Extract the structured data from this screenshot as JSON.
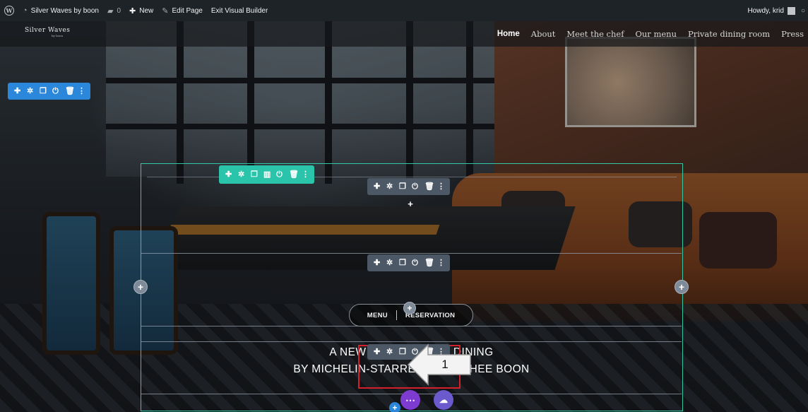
{
  "adminbar": {
    "site_name": "Silver Waves by boon",
    "comments_count": "0",
    "new_label": "New",
    "edit_page_label": "Edit Page",
    "exit_builder_label": "Exit Visual Builder",
    "howdy_label": "Howdy, krid"
  },
  "site": {
    "logo_text": "Silver Waves",
    "logo_sub": "by boon",
    "nav": [
      "Home",
      "About",
      "Meet the chef",
      "Our menu",
      "Private dining room",
      "Press"
    ]
  },
  "hero": {
    "button_menu": "MENU",
    "button_reservation": "RESERVATION",
    "headline_line1": "A NEW WAVE OF FINE DINING",
    "headline_line2": "BY MICHELIN-STARRED CHEF CHEE BOON"
  },
  "toolbar_icons": {
    "section": [
      "move-icon",
      "settings-icon",
      "duplicate-icon",
      "disable-icon",
      "delete-icon",
      "more-icon"
    ],
    "row": [
      "move-icon",
      "settings-icon",
      "duplicate-icon",
      "columns-icon",
      "disable-icon",
      "delete-icon",
      "more-icon"
    ],
    "module": [
      "move-icon",
      "settings-icon",
      "duplicate-icon",
      "disable-icon",
      "delete-icon",
      "more-icon"
    ]
  },
  "annotation": {
    "callout_number": "1",
    "highlight_color": "#d3202a"
  },
  "colors": {
    "adminbar_bg": "#1d2327",
    "section_toolbar": "#2b87da",
    "row_toolbar": "#29c4a9",
    "module_toolbar": "#4c5866",
    "row_outline": "#32c8a6",
    "fab_more": "#7e3bd0",
    "fab_cloud": "#6a5acd"
  }
}
